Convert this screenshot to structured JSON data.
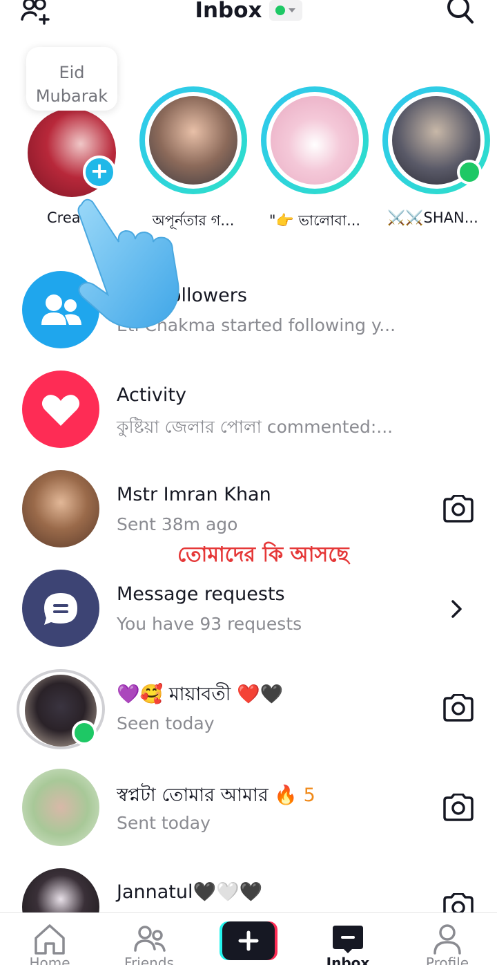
{
  "header": {
    "title": "Inbox",
    "status_color": "#1ec865"
  },
  "note": {
    "line1": "Eid",
    "line2": "Mubarak"
  },
  "stories": [
    {
      "label": "Create",
      "type": "create"
    },
    {
      "label": "অপূর্নতার গ...",
      "type": "story"
    },
    {
      "label": "\"👉 ভালোবা...",
      "type": "story"
    },
    {
      "label": "⚔️⚔️SHAN...",
      "type": "story",
      "online": true
    }
  ],
  "rows": [
    {
      "title": "New followers",
      "subtitle": "Eti Chakma started following y...",
      "icon": "people-icon",
      "color": "#1fa6ed"
    },
    {
      "title": "Activity",
      "subtitle": "কুষ্টিয়া জেলার পোলা commented:...",
      "icon": "heart-icon",
      "color": "#fe2c55"
    },
    {
      "title": "Mstr Imran Khan",
      "subtitle": "Sent 38m ago",
      "action": "camera-icon"
    },
    {
      "title": "Message requests",
      "subtitle": "You have 93 requests",
      "icon": "chat-bubble-icon",
      "color": "#3d4474",
      "action": "chevron-right-icon"
    },
    {
      "title": "💜🥰 মায়াবতী ❤️🖤",
      "subtitle": "Seen today",
      "action": "camera-icon",
      "online": true
    },
    {
      "title": "স্বপ্নটা তোমার আমার 🔥",
      "streak": "5",
      "subtitle": "Sent today",
      "action": "camera-icon"
    },
    {
      "title": "Jannatul🖤🤍🖤",
      "subtitle": "",
      "action": "camera-icon"
    }
  ],
  "overlay_text": "তোমাদের কি আসছে",
  "nav": {
    "home": "Home",
    "friends": "Friends",
    "inbox": "Inbox",
    "profile": "Profile"
  },
  "colors": {
    "accent": "#20b8e8",
    "ring": "#2ee0c8",
    "online": "#1ec865",
    "streak": "#f08a1a"
  }
}
